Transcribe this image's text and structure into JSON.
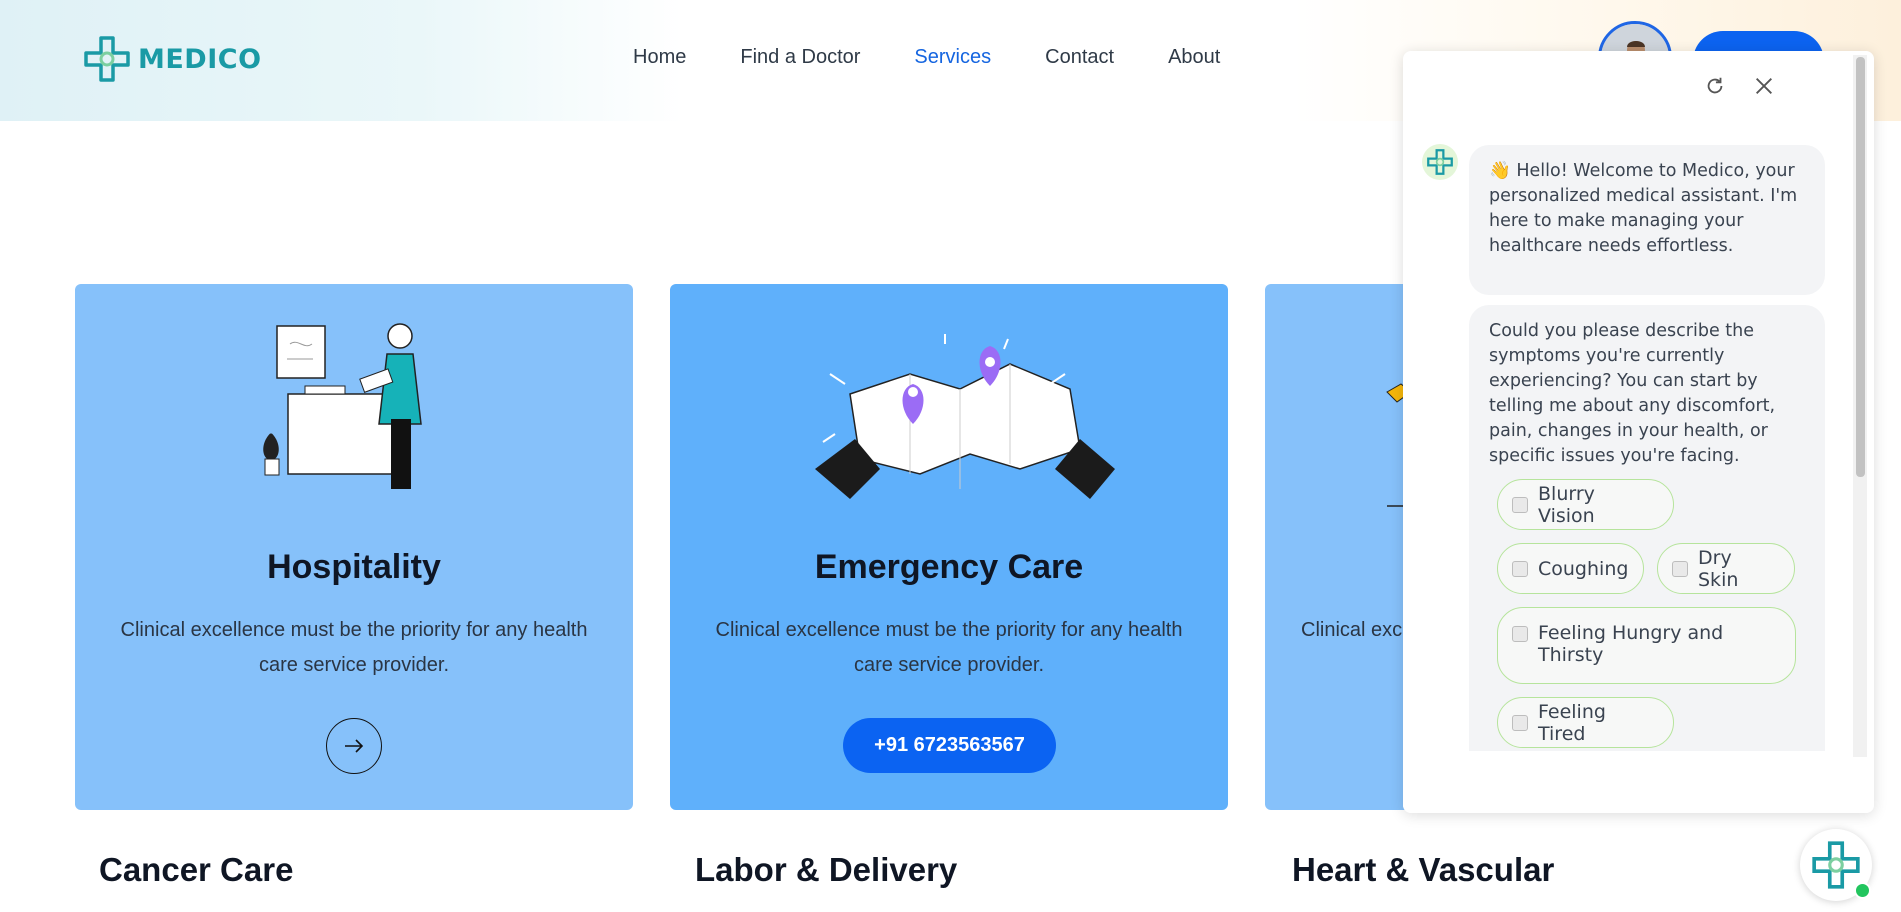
{
  "brand": {
    "name": "MEDICO",
    "color": "#1a9aa5"
  },
  "nav": {
    "items": [
      {
        "label": "Home",
        "active": false
      },
      {
        "label": "Find a Doctor",
        "active": false
      },
      {
        "label": "Services",
        "active": true
      },
      {
        "label": "Contact",
        "active": false
      },
      {
        "label": "About",
        "active": false
      }
    ]
  },
  "cards": [
    {
      "title": "Hospitality",
      "description": "Clinical excellence must be the priority for any health care service provider.",
      "illustration": "doctor-illustration",
      "action_icon": "arrow-right-icon"
    },
    {
      "title": "Emergency Care",
      "description": "Clinical excellence must be the priority for any health care service provider.",
      "illustration": "map-illustration",
      "phone": "+91 6723563567"
    },
    {
      "title": "",
      "description": "Clinical exc"
    }
  ],
  "sections": [
    {
      "title": "Cancer Care"
    },
    {
      "title": "Labor & Delivery"
    },
    {
      "title": "Heart & Vascular"
    }
  ],
  "chat": {
    "refresh_icon": "refresh-icon",
    "close_icon": "close-icon",
    "messages": [
      {
        "text": "👋 Hello! Welcome to Medico, your personalized medical assistant. I'm here to make managing your healthcare needs effortless."
      },
      {
        "text": "Could you please describe the symptoms you're currently experiencing? You can start by telling me about any discomfort, pain, changes in your health, or specific issues you're facing."
      }
    ],
    "options": [
      {
        "label": "Blurry Vision",
        "checked": false
      },
      {
        "label": "Coughing",
        "checked": false
      },
      {
        "label": "Dry Skin",
        "checked": false
      },
      {
        "label": "Feeling Hungry and Thirsty",
        "checked": false
      },
      {
        "label": "Feeling Tired",
        "checked": false
      }
    ],
    "accent": "#b6e49c"
  },
  "colors": {
    "primary": "#0b63f2",
    "nav_active": "#1565e0",
    "card_light": "#86c1fa",
    "card_mid": "#5fb0fb"
  }
}
